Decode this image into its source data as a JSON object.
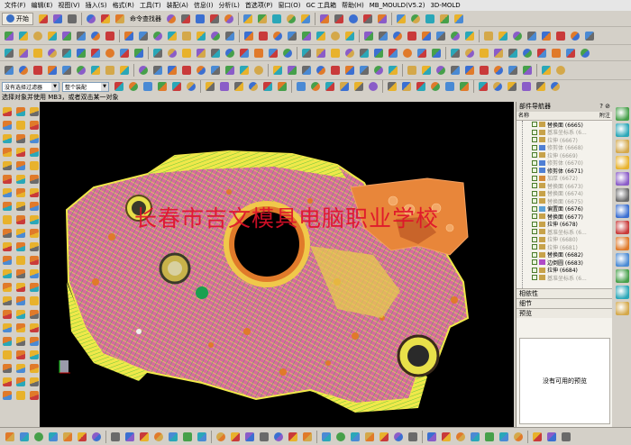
{
  "menubar": {
    "items": [
      "文件(F)",
      "编辑(E)",
      "视图(V)",
      "插入(S)",
      "格式(R)",
      "工具(T)",
      "装配(A)",
      "信息(I)",
      "分析(L)",
      "首选项(P)",
      "窗口(O)",
      "GC 工具箱",
      "帮助(H)",
      "MB_MOULD(V5.2)",
      "3D-MOLD"
    ]
  },
  "toolbar1": {
    "start_label": "开始",
    "command_finder": "命令查找器"
  },
  "selection": {
    "filter_value": "没有选择过滤器",
    "scope_value": "整个装配"
  },
  "status": {
    "prompt": "选择对象并使用 MB3，或者双击某一对象"
  },
  "viewport": {
    "watermark": "长春市吉文模具电脑职业学校"
  },
  "navigator": {
    "title": "部件导航器",
    "col_name": "名称",
    "col_right": "附注",
    "items": [
      {
        "label": "替换面 (6665)",
        "grey": false,
        "icon": "#c7a24a"
      },
      {
        "label": "基准坐标系 (6...",
        "grey": true,
        "icon": "#c7a24a"
      },
      {
        "label": "拉伸 (6667)",
        "grey": true,
        "icon": "#c7a24a"
      },
      {
        "label": "修剪体 (6668)",
        "grey": true,
        "icon": "#4f7fd4"
      },
      {
        "label": "拉伸 (6669)",
        "grey": true,
        "icon": "#c7a24a"
      },
      {
        "label": "修剪体 (6670)",
        "grey": true,
        "icon": "#4f7fd4"
      },
      {
        "label": "修剪体 (6671)",
        "grey": false,
        "icon": "#4f7fd4"
      },
      {
        "label": "加厚 (6672)",
        "grey": true,
        "icon": "#d48a3a"
      },
      {
        "label": "替换面 (6673)",
        "grey": true,
        "icon": "#c7a24a"
      },
      {
        "label": "替换面 (6674)",
        "grey": true,
        "icon": "#c7a24a"
      },
      {
        "label": "替换面 (6675)",
        "grey": true,
        "icon": "#c7a24a"
      },
      {
        "label": "偏置面 (6676)",
        "grey": false,
        "icon": "#5aa0d8"
      },
      {
        "label": "替换面 (6677)",
        "grey": false,
        "icon": "#c7a24a"
      },
      {
        "label": "拉伸 (6678)",
        "grey": false,
        "icon": "#c7a24a"
      },
      {
        "label": "基准坐标系 (6...",
        "grey": true,
        "icon": "#c7a24a"
      },
      {
        "label": "拉伸 (6680)",
        "grey": true,
        "icon": "#c7a24a"
      },
      {
        "label": "拉伸 (6681)",
        "grey": true,
        "icon": "#c7a24a"
      },
      {
        "label": "替换面 (6682)",
        "grey": false,
        "icon": "#c7a24a"
      },
      {
        "label": "边倒圆 (6683)",
        "grey": false,
        "icon": "#b04ac7"
      },
      {
        "label": "拉伸 (6684)",
        "grey": false,
        "icon": "#c7a24a"
      },
      {
        "label": "基准坐标系 (6...",
        "grey": true,
        "icon": "#c7a24a"
      }
    ],
    "sections": [
      "相依性",
      "细节",
      "预览"
    ],
    "preview_text": "没有可用的预览"
  },
  "icons": {
    "toolbar_colors": [
      "#3b6fd1",
      "#e8b22c",
      "#46a04a",
      "#c93a3a",
      "#8a5cc8",
      "#2aa7b8",
      "#e07a2a",
      "#6a6a6a",
      "#d4a84a",
      "#4a8ad4"
    ]
  }
}
